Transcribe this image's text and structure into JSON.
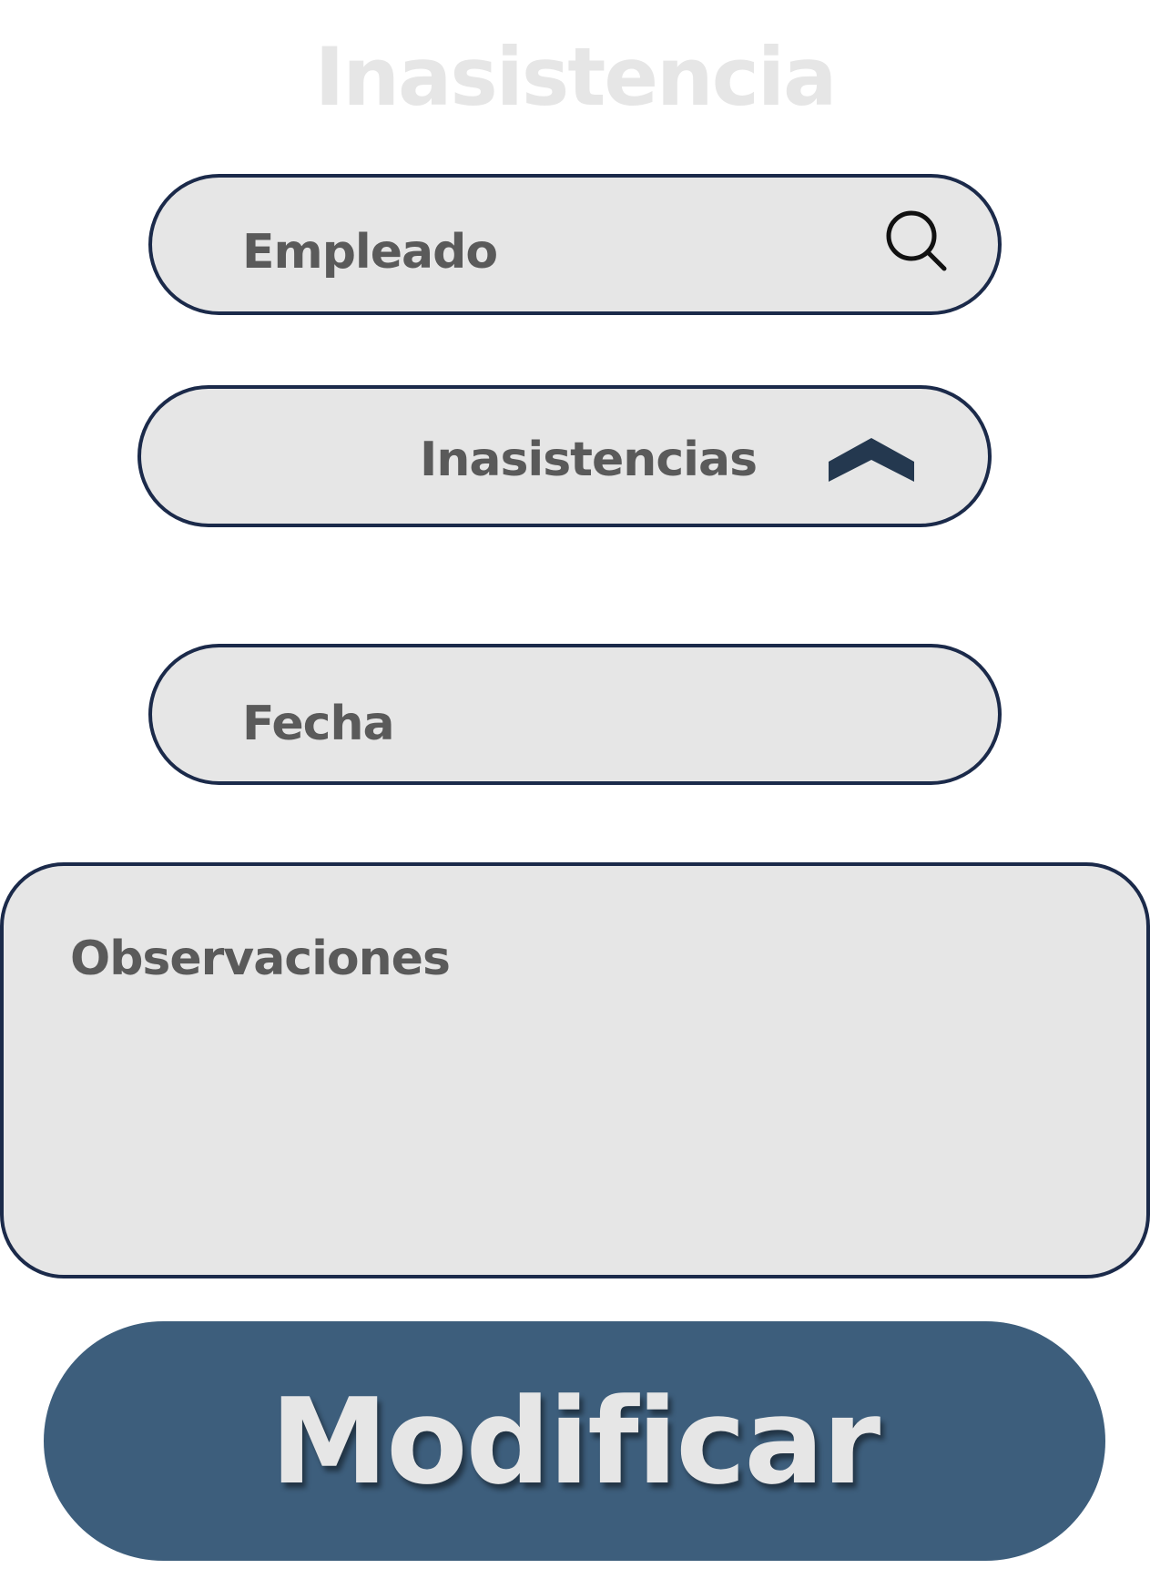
{
  "header": {
    "title": "Inasistencia"
  },
  "form": {
    "empleado": {
      "placeholder": "Empleado",
      "icon": "search-icon"
    },
    "inasistencias": {
      "selected": "Inasistencias",
      "icon": "chevron-up-icon"
    },
    "fecha": {
      "placeholder": "Fecha"
    },
    "observaciones": {
      "placeholder": "Observaciones"
    }
  },
  "actions": {
    "modificar_label": "Modificar"
  },
  "colors": {
    "field_background": "#e6e6e6",
    "field_border": "#1b2a4a",
    "label_text": "#5a5a5a",
    "button_background": "#3d5e7c",
    "button_text": "#e6e6e6",
    "title_text": "#e6e6e6"
  }
}
